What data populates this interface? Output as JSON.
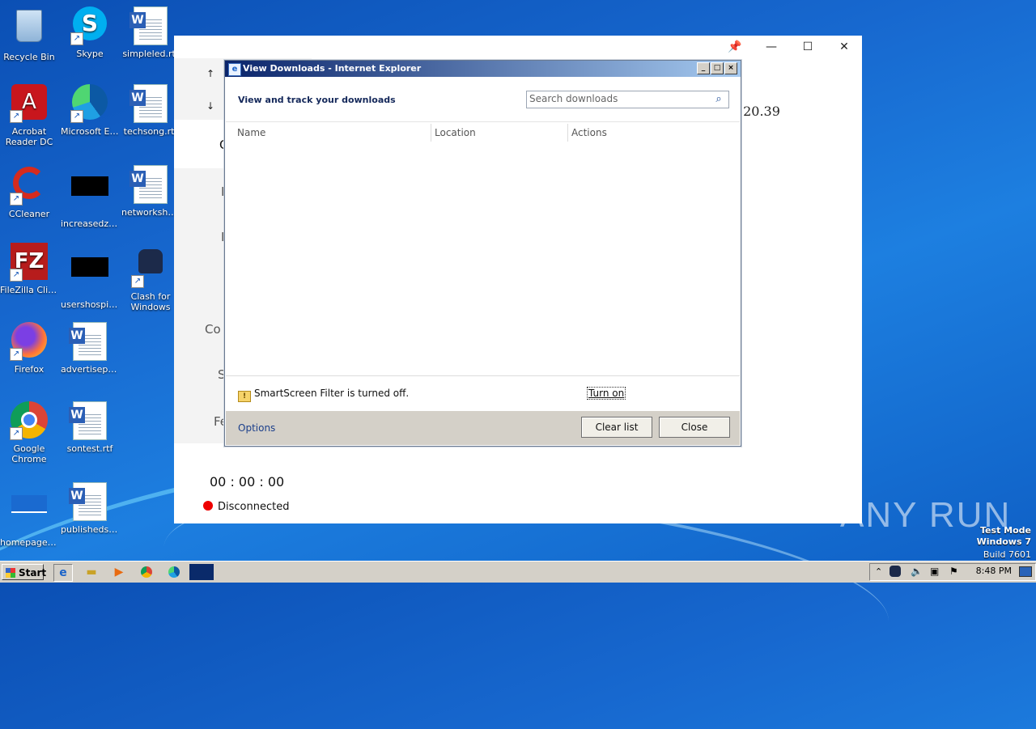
{
  "desktop": {
    "icons": [
      {
        "label": "Recycle Bin"
      },
      {
        "label": "Skype"
      },
      {
        "label": "simpleled.rtf"
      },
      {
        "label": "Acrobat Reader DC"
      },
      {
        "label": "Microsoft Edge"
      },
      {
        "label": "techsong.rtf"
      },
      {
        "label": "CCleaner"
      },
      {
        "label": "increasedze..."
      },
      {
        "label": "networksha..."
      },
      {
        "label": "FileZilla Client"
      },
      {
        "label": "usershospit..."
      },
      {
        "label": "Clash for Windows"
      },
      {
        "label": "Firefox"
      },
      {
        "label": "advertisepa..."
      },
      {
        "label": "Google Chrome"
      },
      {
        "label": "sontest.rtf"
      },
      {
        "label": "homepagep..."
      },
      {
        "label": "publishedst..."
      }
    ]
  },
  "bg_app": {
    "timer": "00 : 00 : 00",
    "status": "Disconnected",
    "ip_fragment": ".20.39",
    "side_fragments": [
      "C",
      "I",
      "I",
      "Co",
      "S",
      "Fe"
    ],
    "arrow_up": "↑",
    "arrow_down": "↓"
  },
  "dialog": {
    "title": "View Downloads - Internet Explorer",
    "heading": "View and track your downloads",
    "search_placeholder": "Search downloads",
    "columns": [
      "Name",
      "Location",
      "Actions"
    ],
    "smartscreen_text": "SmartScreen Filter is turned off.",
    "turn_on": "Turn on",
    "options": "Options",
    "clear_list": "Clear list",
    "close": "Close"
  },
  "taskbar": {
    "start": "Start",
    "clock": "8:48 PM"
  },
  "watermark": {
    "line1": "Test Mode",
    "line2": "Windows 7",
    "line3": "Build 7601",
    "brand": "ANY RUN"
  }
}
